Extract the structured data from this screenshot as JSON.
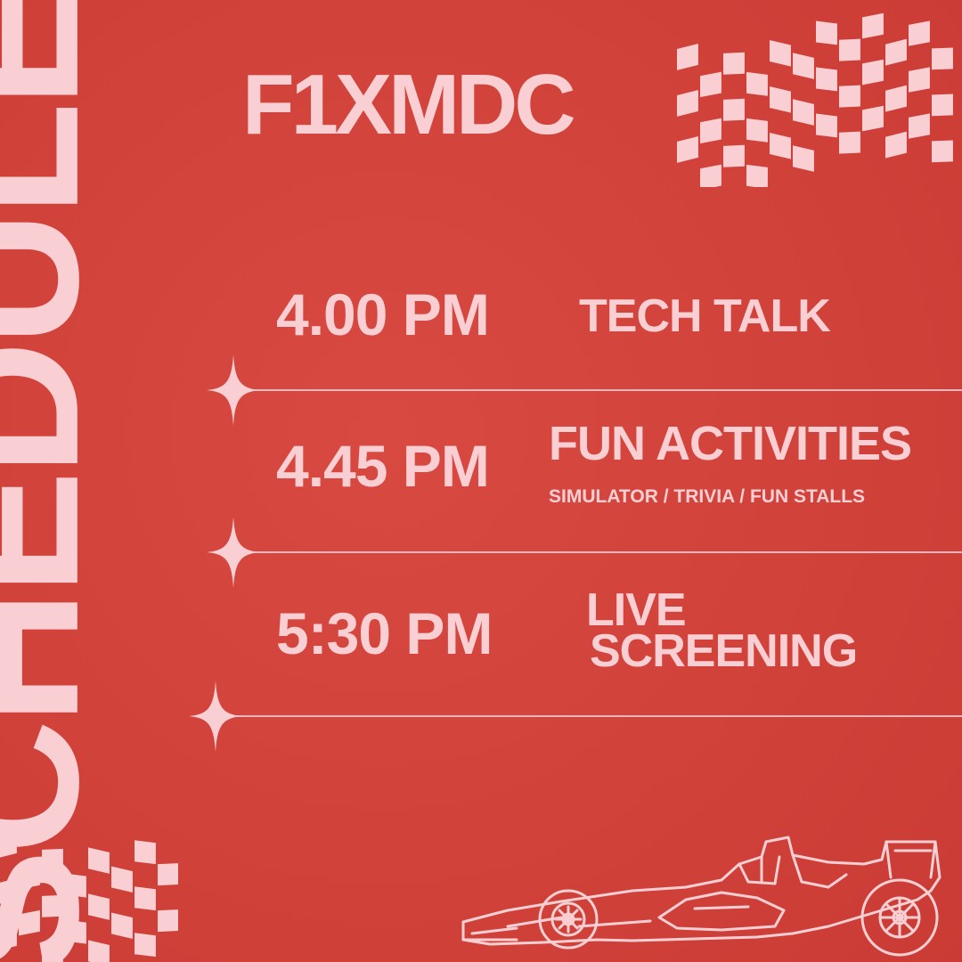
{
  "title": "SCHEDULE",
  "brand": "F1XMDC",
  "schedule": [
    {
      "time": "4.00 PM",
      "event": "TECH TALK",
      "sub": ""
    },
    {
      "time": "4.45 PM",
      "event": "FUN ACTIVITIES",
      "sub": "SIMULATOR / TRIVIA / FUN STALLS"
    },
    {
      "time": "5:30 PM",
      "event_line1": "LIVE",
      "event_line2": "SCREENING"
    }
  ],
  "colors": {
    "background": "#d1433b",
    "foreground": "#f9cfd3"
  },
  "icons": [
    "checkered-flag-icon",
    "sparkle-icon",
    "race-car-icon"
  ]
}
